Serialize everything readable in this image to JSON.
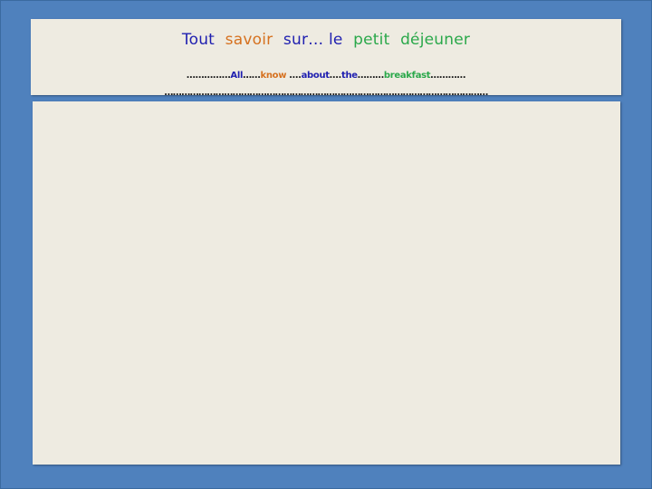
{
  "title": {
    "words": [
      "Tout",
      "savoir",
      "sur… le",
      "petit",
      "déjeuner"
    ]
  },
  "subtitle": {
    "lead_dots": "……………",
    "w1": "All",
    "d1": "……",
    "w2": "know",
    "d2": " ….",
    "w3": "about",
    "d3": "….",
    "w4": "the",
    "d4": "………",
    "w5": "breakfast",
    "tail_dots": "…………"
  },
  "dots_line": "……………………………………………………………………………………………………"
}
